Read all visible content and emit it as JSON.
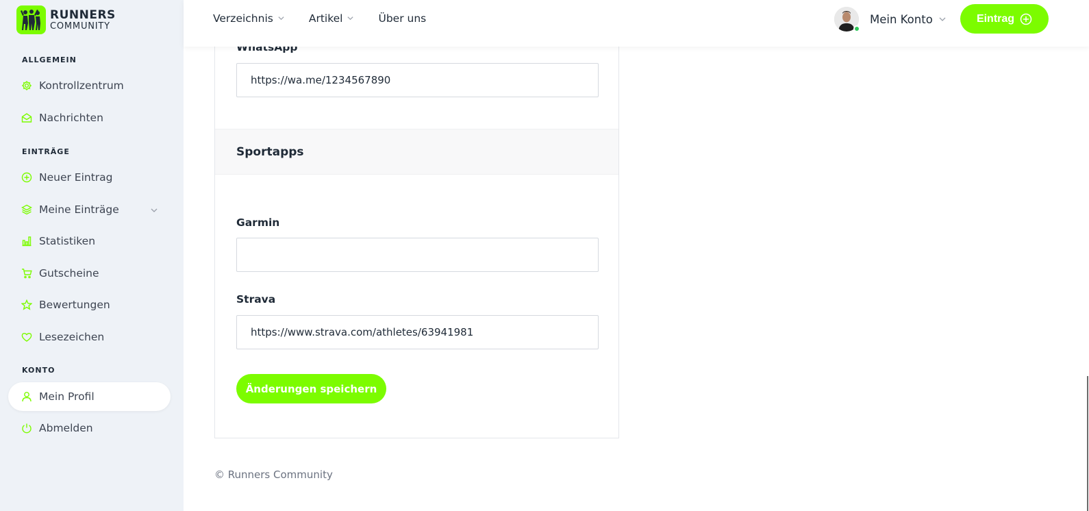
{
  "brand": {
    "line1": "RUNNERS",
    "line2": "COMMUNITY"
  },
  "colors": {
    "accent": "#7cfc00",
    "online": "#2ec85a"
  },
  "sidebar": {
    "sections": [
      {
        "title": "ALLGEMEIN"
      },
      {
        "title": "EINTRÄGE"
      },
      {
        "title": "KONTO"
      }
    ],
    "items": [
      {
        "label": "Kontrollzentrum",
        "icon": "settings-icon"
      },
      {
        "label": "Nachrichten",
        "icon": "mail-open-icon"
      },
      {
        "label": "Neuer Eintrag",
        "icon": "plus-circle-icon"
      },
      {
        "label": "Meine Einträge",
        "icon": "layers-icon",
        "expandable": true
      },
      {
        "label": "Statistiken",
        "icon": "bar-chart-icon"
      },
      {
        "label": "Gutscheine",
        "icon": "cart-icon"
      },
      {
        "label": "Bewertungen",
        "icon": "star-icon"
      },
      {
        "label": "Lesezeichen",
        "icon": "heart-icon"
      },
      {
        "label": "Mein Profil",
        "icon": "user-icon",
        "active": true
      },
      {
        "label": "Abmelden",
        "icon": "power-icon"
      }
    ]
  },
  "header": {
    "nav": [
      {
        "label": "Verzeichnis",
        "dropdown": true
      },
      {
        "label": "Artikel",
        "dropdown": true
      },
      {
        "label": "Über uns",
        "dropdown": false
      }
    ],
    "account_label": "Mein Konto",
    "entry_button": "Eintrag"
  },
  "form": {
    "whatsapp": {
      "label": "WhatsApp",
      "value": "https://wa.me/1234567890"
    },
    "section_title": "Sportapps",
    "garmin": {
      "label": "Garmin",
      "value": ""
    },
    "strava": {
      "label": "Strava",
      "value": "https://www.strava.com/athletes/63941981"
    },
    "save_button": "Änderungen speichern"
  },
  "footer": {
    "copyright": "© Runners Community"
  }
}
